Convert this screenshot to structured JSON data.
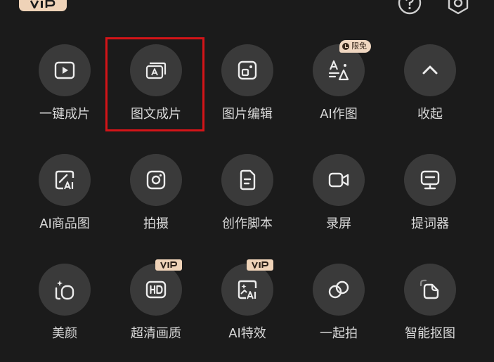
{
  "top_bar": {
    "badge_icon": "vip-badge",
    "help_icon": "help-circle-icon",
    "settings_icon": "settings-icon"
  },
  "grid": {
    "rows": [
      [
        {
          "label": "一键成片",
          "icon": "play-square-icon"
        },
        {
          "label": "图文成片",
          "icon": "text-image-icon"
        },
        {
          "label": "图片编辑",
          "icon": "image-edit-icon"
        },
        {
          "label": "AI作图",
          "icon": "ai-draw-icon",
          "tag": "限免"
        },
        {
          "label": "收起",
          "icon": "chevron-up-icon"
        }
      ],
      [
        {
          "label": "AI商品图",
          "icon": "ai-product-icon"
        },
        {
          "label": "拍摄",
          "icon": "camera-icon"
        },
        {
          "label": "创作脚本",
          "icon": "script-icon"
        },
        {
          "label": "录屏",
          "icon": "screen-record-icon"
        },
        {
          "label": "提词器",
          "icon": "teleprompter-icon"
        }
      ],
      [
        {
          "label": "美颜",
          "icon": "beauty-icon"
        },
        {
          "label": "超清画质",
          "icon": "hd-icon",
          "tag_icon": "vip-badge"
        },
        {
          "label": "AI特效",
          "icon": "ai-effect-icon",
          "tag_icon": "vip-badge"
        },
        {
          "label": "一起拍",
          "icon": "duet-icon"
        },
        {
          "label": "智能抠图",
          "icon": "cutout-icon"
        }
      ]
    ]
  },
  "colors": {
    "background": "#1b1b1b",
    "tile_circle": "#3a3a3a",
    "label_text": "#d9d9d9",
    "vip_gold": "#efd3b8",
    "highlight_red": "#d41418"
  }
}
